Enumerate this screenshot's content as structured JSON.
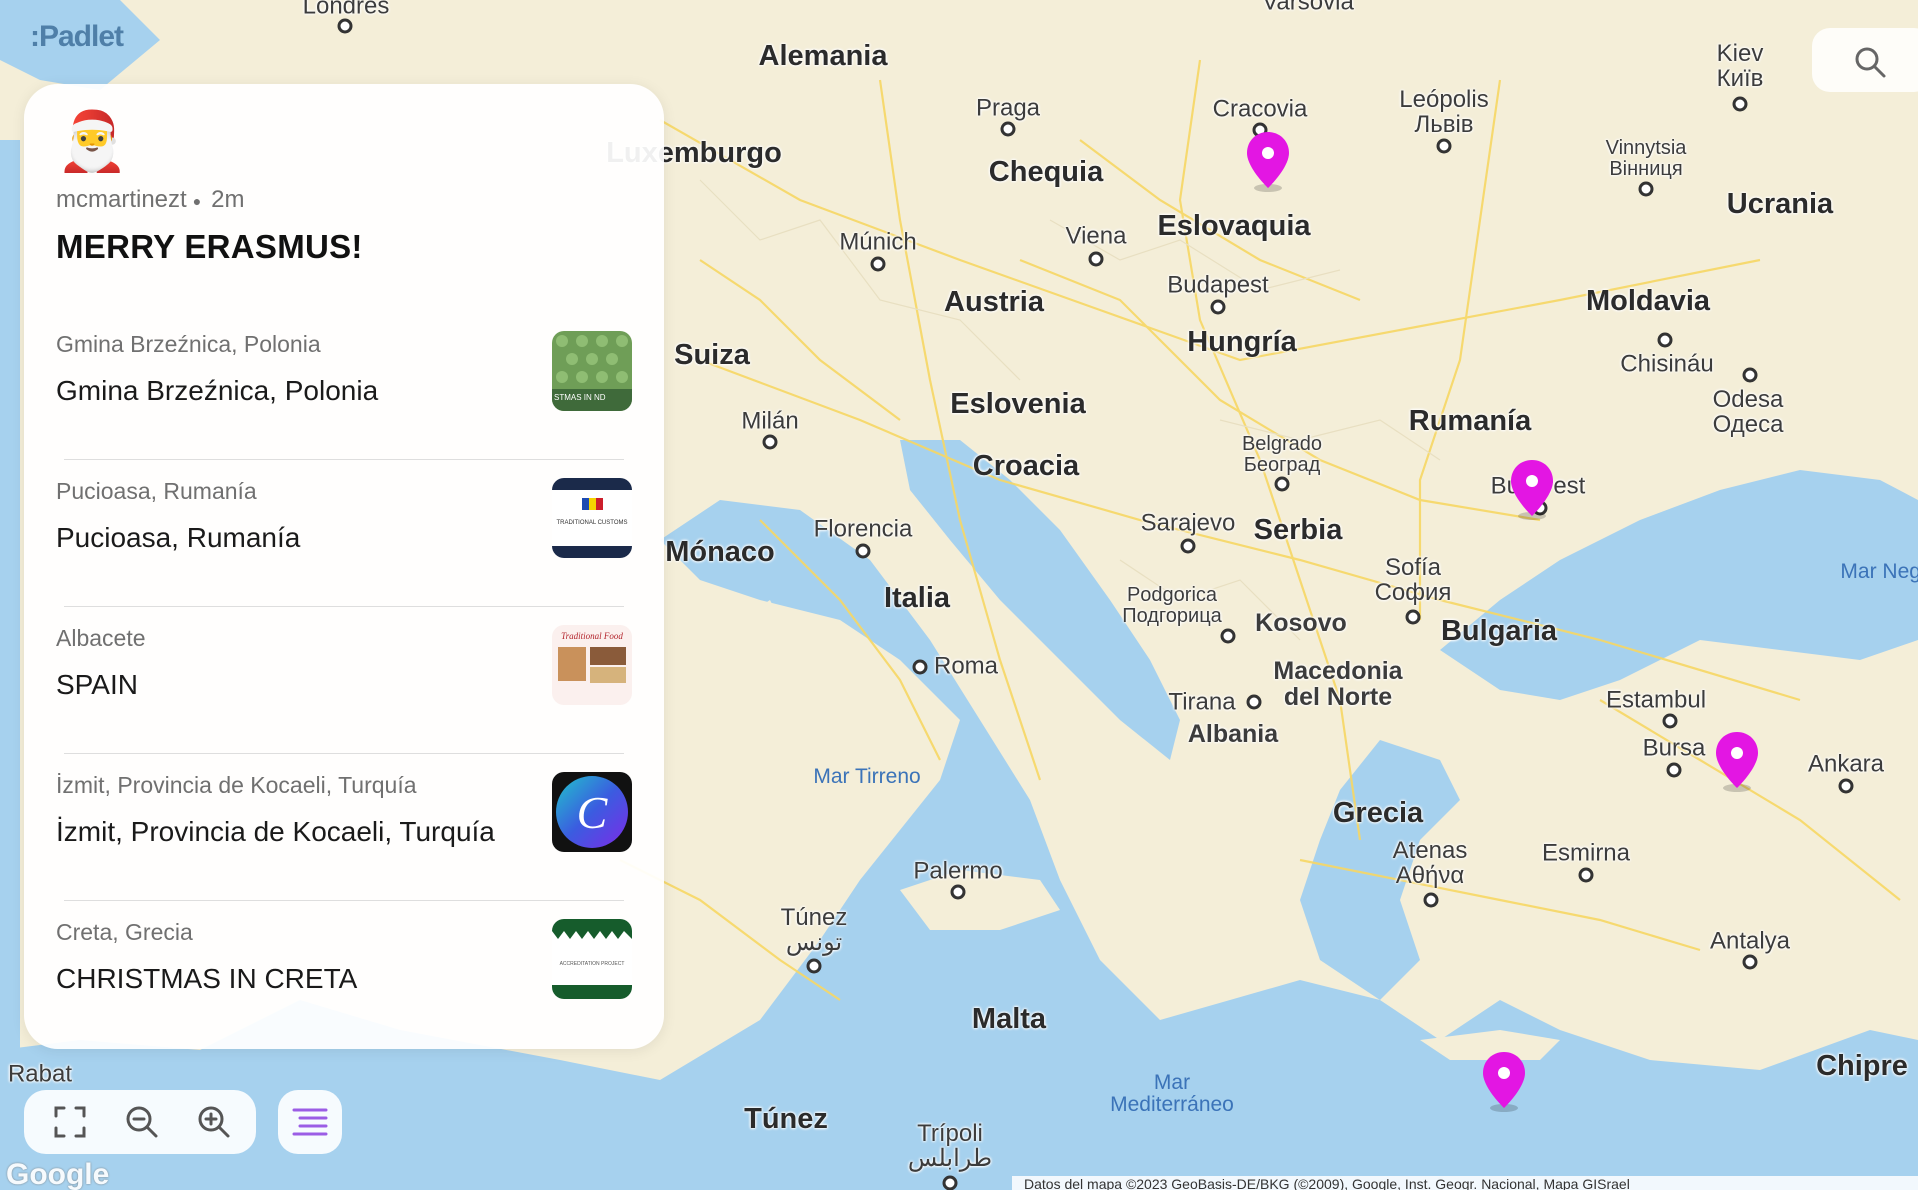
{
  "app": {
    "logo_text": ":Padlet",
    "colors": {
      "pin": "#e316e3",
      "water": "#a6d1ee",
      "land": "#f4eed8",
      "road": "#f7d764",
      "accent": "#9b5de5"
    }
  },
  "search": {
    "icon": "search-icon"
  },
  "post": {
    "emoji": "🎅",
    "author": "mcmartinezt",
    "time": "2m",
    "title": "MERRY ERASMUS!"
  },
  "locations": [
    {
      "subtitle": "Gmina Brzeźnica, Polonia",
      "title": "Gmina Brzeźnica, Polonia",
      "thumb_text": "STMAS IN ND"
    },
    {
      "subtitle": "Pucioasa, Rumanía",
      "title": "Pucioasa, Rumanía",
      "thumb_text": "TRADITIONAL CUSTOMS"
    },
    {
      "subtitle": "Albacete",
      "title": "SPAIN",
      "thumb_text": "Traditional Food"
    },
    {
      "subtitle": "İzmit, Provincia de Kocaeli, Turquía",
      "title": "İzmit, Provincia de Kocaeli, Turquía",
      "thumb_text": "C"
    },
    {
      "subtitle": "Creta, Grecia",
      "title": "CHRISTMAS IN CRETA",
      "thumb_text": "ACCREDITATION PROJECT"
    }
  ],
  "map_controls": {
    "fullscreen": "fullscreen-icon",
    "zoom_out": "zoom-out-icon",
    "zoom_in": "zoom-in-icon",
    "list": "list-icon"
  },
  "map_labels": {
    "countries": [
      "Alemania",
      "Chequia",
      "Eslovaquia",
      "Austria",
      "Hungría",
      "Suiza",
      "Eslovenia",
      "Croacia",
      "Italia",
      "Serbia",
      "Kosovo",
      "Bulgaria",
      "Macedonia del Norte",
      "Albania",
      "Grecia",
      "Moldavia",
      "Ucrania",
      "Rumanía",
      "Malta",
      "Túnez",
      "Chipre"
    ],
    "cities": [
      "Londres",
      "Varsovia",
      "Kiev Київ",
      "Praga",
      "Cracovia",
      "Leópolis Львів",
      "Vinnytsia Вінниця",
      "Múnich",
      "Viena",
      "Budapest",
      "Chisináu",
      "Odesa Одеса",
      "Milán",
      "Belgrado Београд",
      "Bucarest",
      "Florencia",
      "Sarajevo",
      "Sofía София",
      "Podgorica Подгорица",
      "Roma",
      "Tirana",
      "Estambul",
      "Bursa",
      "Ankara",
      "Atenas Αθήνα",
      "Esmirna",
      "Palermo",
      "Túnez تونس",
      "Antalya",
      "Trípoli طرابلس",
      "Rabat",
      "Mónaco",
      "Luxemburgo"
    ],
    "seas": [
      "Mar Tirreno",
      "Mar Mediterráneo",
      "Mar Negro"
    ]
  },
  "branding": {
    "google": "Google"
  },
  "attribution": "Datos del mapa ©2023 GeoBasis-DE/BKG (©2009), Google, Inst. Geogr. Nacional, Mapa GISrael"
}
